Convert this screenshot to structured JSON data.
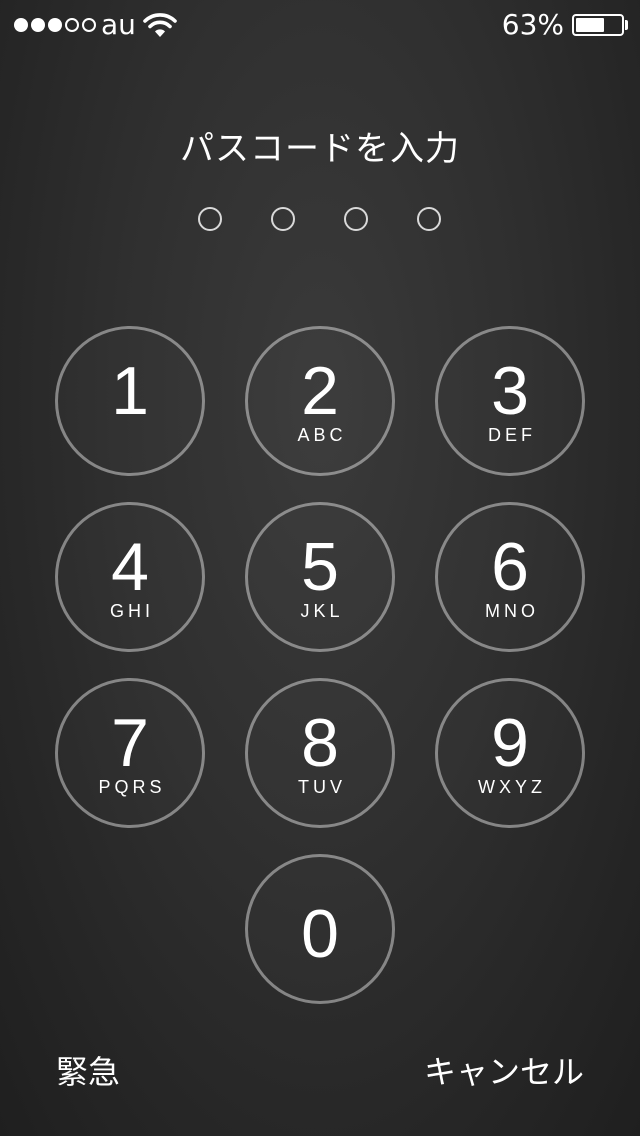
{
  "status_bar": {
    "signal_dots": [
      true,
      true,
      true,
      false,
      false
    ],
    "carrier": "au",
    "battery_percent_text": "63%",
    "battery_level": 0.63
  },
  "title": "パスコードを入力",
  "passcode": {
    "length": 4,
    "entered": 0
  },
  "keypad": [
    {
      "digit": "1",
      "letters": ""
    },
    {
      "digit": "2",
      "letters": "ABC"
    },
    {
      "digit": "3",
      "letters": "DEF"
    },
    {
      "digit": "4",
      "letters": "GHI"
    },
    {
      "digit": "5",
      "letters": "JKL"
    },
    {
      "digit": "6",
      "letters": "MNO"
    },
    {
      "digit": "7",
      "letters": "PQRS"
    },
    {
      "digit": "8",
      "letters": "TUV"
    },
    {
      "digit": "9",
      "letters": "WXYZ"
    },
    {
      "digit": "0",
      "letters": ""
    }
  ],
  "buttons": {
    "emergency": "緊急",
    "cancel": "キャンセル"
  }
}
